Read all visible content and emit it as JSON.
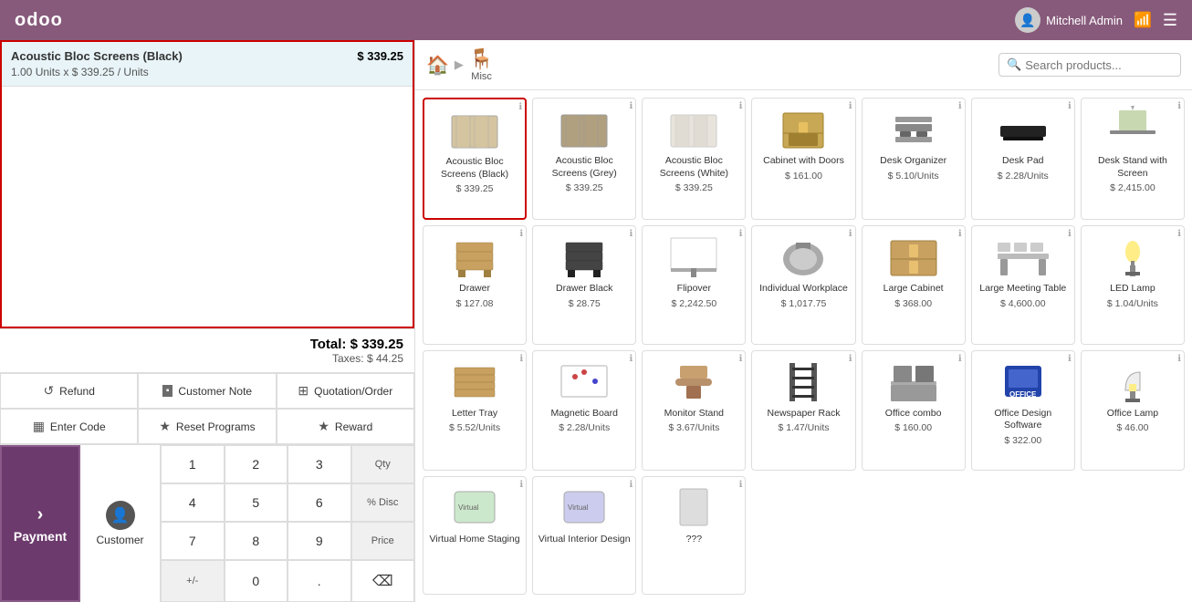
{
  "topbar": {
    "logo": "odoo",
    "user": "Mitchell Admin",
    "wifi_icon": "wifi",
    "menu_icon": "menu"
  },
  "order": {
    "line": {
      "name": "Acoustic Bloc Screens (Black)",
      "qty_label": "1.00  Units x $ 339.25 / Units",
      "price": "$ 339.25"
    },
    "total_label": "Total: $ 339.25",
    "taxes_label": "Taxes: $ 44.25"
  },
  "action_buttons": [
    {
      "id": "refund",
      "icon": "↺",
      "label": "Refund"
    },
    {
      "id": "customer-note",
      "icon": "▪",
      "label": "Customer Note"
    },
    {
      "id": "quotation",
      "icon": "⊞",
      "label": "Quotation/Order"
    },
    {
      "id": "enter-code",
      "icon": "▦",
      "label": "Enter Code"
    },
    {
      "id": "reset-programs",
      "icon": "★",
      "label": "Reset Programs"
    },
    {
      "id": "reward",
      "icon": "★",
      "label": "Reward"
    }
  ],
  "numpad": {
    "customer_label": "Customer",
    "keys": [
      [
        "1",
        "2",
        "3",
        "Qty"
      ],
      [
        "4",
        "5",
        "6",
        "% Disc"
      ],
      [
        "7",
        "8",
        "9",
        "Price"
      ],
      [
        "+/-",
        "0",
        ".",
        "⌫"
      ]
    ],
    "payment_label": "Payment"
  },
  "breadcrumb": {
    "home_icon": "🏠",
    "separator": "▶",
    "current_label": "Misc",
    "current_icon": "🪑"
  },
  "search": {
    "placeholder": "Search products..."
  },
  "products": [
    {
      "id": 1,
      "name": "Acoustic Bloc Screens (Black)",
      "price": "$ 339.25",
      "selected": true,
      "color": "#d4c4a0"
    },
    {
      "id": 2,
      "name": "Acoustic Bloc Screens (Grey)",
      "price": "$ 339.25",
      "color": "#c0b090"
    },
    {
      "id": 3,
      "name": "Acoustic Bloc Screens (White)",
      "price": "$ 339.25",
      "color": "#e8e0cc"
    },
    {
      "id": 4,
      "name": "Cabinet with Doors",
      "price": "$ 161.00",
      "color": "#c8b070"
    },
    {
      "id": 5,
      "name": "Desk Organizer",
      "price": "$ 5.10/Units",
      "color": "#555"
    },
    {
      "id": 6,
      "name": "Desk Pad",
      "price": "$ 2.28/Units",
      "color": "#333"
    },
    {
      "id": 7,
      "name": "Desk Stand with Screen",
      "price": "$ 2,415.00",
      "color": "#a0c060"
    },
    {
      "id": 8,
      "name": "Drawer",
      "price": "$ 127.08",
      "color": "#c8a060"
    },
    {
      "id": 9,
      "name": "Drawer Black",
      "price": "$ 28.75",
      "color": "#444"
    },
    {
      "id": 10,
      "name": "Flipover",
      "price": "$ 2,242.50",
      "color": "#ddd"
    },
    {
      "id": 11,
      "name": "Individual Workplace",
      "price": "$ 1,017.75",
      "color": "#888"
    },
    {
      "id": 12,
      "name": "Large Cabinet",
      "price": "$ 368.00",
      "color": "#c8a060"
    },
    {
      "id": 13,
      "name": "Large Meeting Table",
      "price": "$ 4,600.00",
      "color": "#999"
    },
    {
      "id": 14,
      "name": "LED Lamp",
      "price": "$ 1.04/Units",
      "color": "#555"
    },
    {
      "id": 15,
      "name": "Letter Tray",
      "price": "$ 5.52/Units",
      "color": "#c8a060"
    },
    {
      "id": 16,
      "name": "Magnetic Board",
      "price": "$ 2.28/Units",
      "color": "#eee"
    },
    {
      "id": 17,
      "name": "Monitor Stand",
      "price": "$ 3.67/Units",
      "color": "#b8906a"
    },
    {
      "id": 18,
      "name": "Newspaper Rack",
      "price": "$ 1.47/Units",
      "color": "#333"
    },
    {
      "id": 19,
      "name": "Office combo",
      "price": "$ 160.00",
      "color": "#666"
    },
    {
      "id": 20,
      "name": "Office Design Software",
      "price": "$ 322.00",
      "color": "#3355aa"
    },
    {
      "id": 21,
      "name": "Office Lamp",
      "price": "$ 46.00",
      "color": "#555"
    },
    {
      "id": 22,
      "name": "Virtual Home Staging",
      "price": "",
      "color": "#aaa"
    },
    {
      "id": 23,
      "name": "Virtual Interior Design",
      "price": "",
      "color": "#aaa"
    },
    {
      "id": 24,
      "name": "???",
      "price": "",
      "color": "#ccc"
    }
  ]
}
